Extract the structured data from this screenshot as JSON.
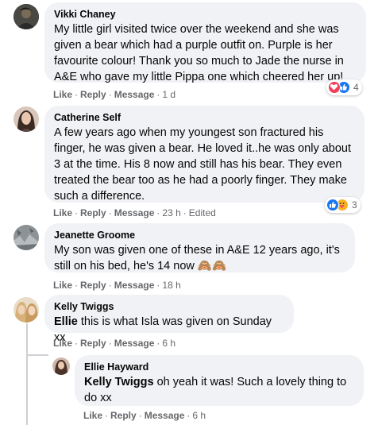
{
  "comments": [
    {
      "author": "Vikki Chaney",
      "text": "My little girl visited twice over the weekend and she was given a bear which had a purple outfit on. Purple is her favourite colour! Thank you so much to Jade the nurse in A&E who gave my little Pippa one which cheered her up!",
      "actions": {
        "like": "Like",
        "reply": "Reply",
        "message": "Message",
        "time": "1 d"
      },
      "reactions": {
        "icons": [
          "love",
          "like"
        ],
        "count": "4"
      }
    },
    {
      "author": "Catherine Self",
      "text": "A few years ago when my youngest son fractured his finger, he was given a bear. He loved it..he was only about 3 at the time. His 8 now and still has his bear. They even treated the bear too as he had a poorly finger. They make such a difference.",
      "actions": {
        "like": "Like",
        "reply": "Reply",
        "message": "Message",
        "time": "23 h",
        "edited": "Edited"
      },
      "reactions": {
        "icons": [
          "like",
          "care"
        ],
        "count": "3"
      }
    },
    {
      "author": "Jeanette Groome",
      "text": "My son was given one of these in A&E 12 years ago, it's still on his bed, he's 14 now 🙈🙈",
      "actions": {
        "like": "Like",
        "reply": "Reply",
        "message": "Message",
        "time": "18 h"
      }
    },
    {
      "author": "Kelly Twiggs",
      "mention": "Ellie",
      "text": " this is what Isla was given on Sunday xx",
      "actions": {
        "like": "Like",
        "reply": "Reply",
        "message": "Message",
        "time": "6 h"
      }
    }
  ],
  "reply": {
    "author": "Ellie Hayward",
    "mention": "Kelly Twiggs",
    "text": " oh yeah it was! Such a lovely thing to do xx",
    "actions": {
      "like": "Like",
      "reply": "Reply",
      "message": "Message",
      "time": "6 h"
    }
  },
  "colors": {
    "bubble": "#f0f2f5",
    "meta": "#65676b",
    "like": "#1877f2",
    "love": "#f33e58",
    "care": "#f7b125"
  }
}
